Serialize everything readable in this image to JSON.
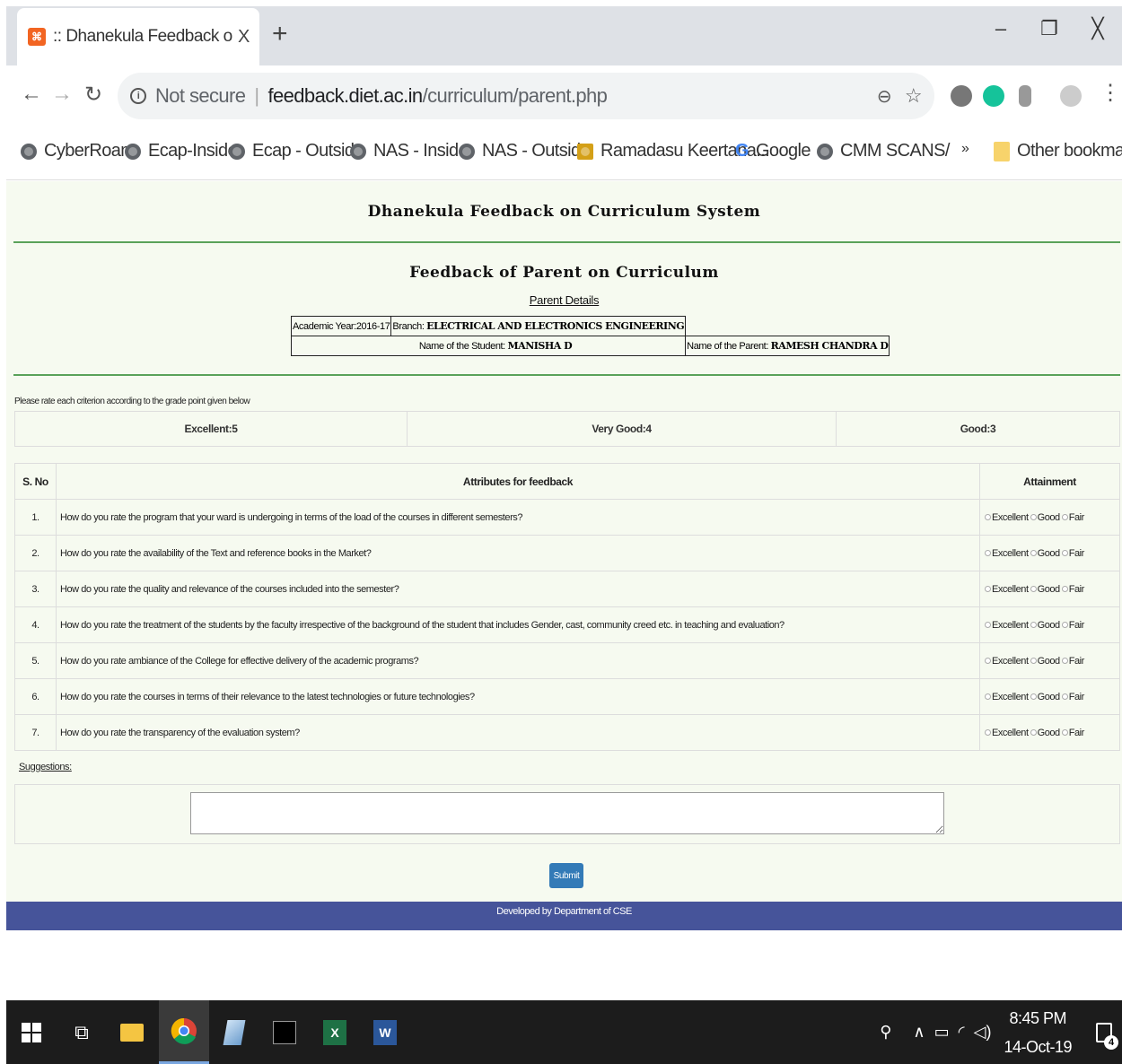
{
  "browser": {
    "tab_title": ":: Dhanekula Feedback on Curricu",
    "tab_close": "X",
    "new_tab": "+",
    "url_not_secure": "Not secure",
    "url_host": "feedback.diet.ac.in",
    "url_path": "/curriculum/parent.php",
    "bookmarks": [
      "CyberRoam",
      "Ecap-Inside",
      "Ecap - Outside",
      "NAS - Inside",
      "NAS - Outside",
      "Ramadasu Keertana...",
      "Google",
      "CMM SCANS/"
    ],
    "bookmarks_overflow": "»",
    "other_bookmarks": "Other bookmarks"
  },
  "page": {
    "site_title": "Dhanekula Feedback on Curriculum System",
    "form_title": "Feedback of Parent on Curriculum",
    "parent_details_link": "Parent Details",
    "details": {
      "academic_year_label": "Academic Year:2016-17",
      "branch_label": "Branch:",
      "branch_value": "ELECTRICAL AND ELECTRONICS ENGINEERING",
      "student_label": "Name of the Student:",
      "student_value": "MANISHA D",
      "parent_label": "Name of the Parent:",
      "parent_value": "RAMESH CHANDRA D"
    },
    "rate_note": "Please rate each criterion according to the grade point given below",
    "grades": [
      "Excellent:5",
      "Very Good:4",
      "Good:3"
    ],
    "table_headers": {
      "sno": "S. No",
      "attributes": "Attributes for feedback",
      "attainment": "Attainment"
    },
    "options": [
      "Excellent",
      "Good",
      "Fair"
    ],
    "questions": [
      {
        "sno": "1.",
        "text": "How do you rate the program that your ward is undergoing in terms of the load of the courses in different semesters?"
      },
      {
        "sno": "2.",
        "text": "How do you rate the availability of the Text and reference books in the Market?"
      },
      {
        "sno": "3.",
        "text": "How do you rate the quality and relevance of the courses included into the semester?"
      },
      {
        "sno": "4.",
        "text": "How do you rate the treatment of the students by the faculty irrespective of the background of the student that includes Gender, cast, community creed etc. in teaching and evaluation?"
      },
      {
        "sno": "5.",
        "text": "How do you rate ambiance of the College for effective delivery of the academic programs?"
      },
      {
        "sno": "6.",
        "text": "How do you rate the courses in terms of their relevance to the latest technologies or future technologies?"
      },
      {
        "sno": "7.",
        "text": "How do you rate the transparency of the evaluation system?"
      }
    ],
    "suggestions_label": "Suggestions:",
    "submit_label": "Submit",
    "footer": "Developed by Department of CSE"
  },
  "taskbar": {
    "time": "8:45 PM",
    "date": "14-Oct-19",
    "notification_count": "4"
  }
}
